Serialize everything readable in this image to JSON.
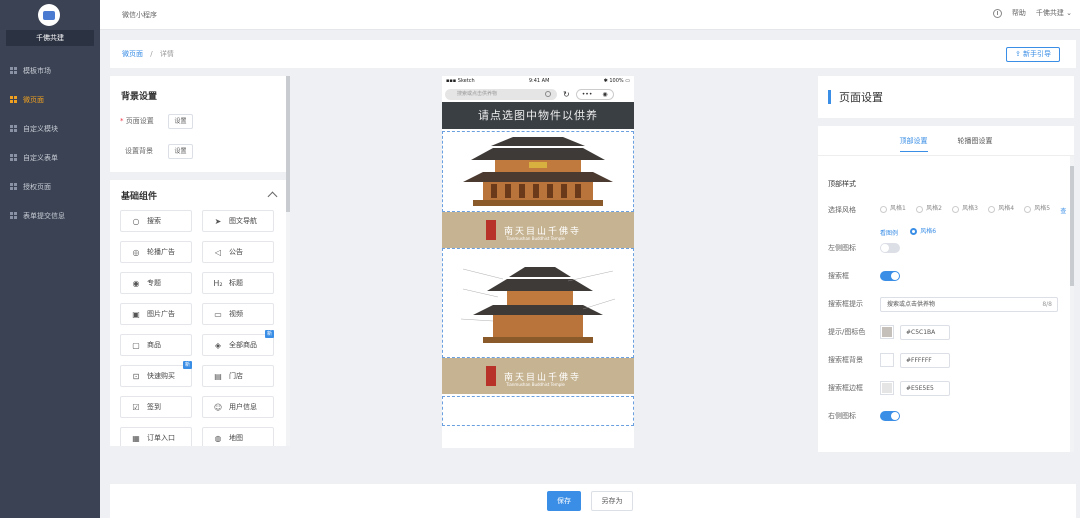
{
  "sidebar": {
    "brand": "千佛共建",
    "items": [
      {
        "label": "模板市场",
        "active": false
      },
      {
        "label": "微页面",
        "active": true
      },
      {
        "label": "自定义模块",
        "active": false
      },
      {
        "label": "自定义表单",
        "active": false
      },
      {
        "label": "授权页面",
        "active": false
      },
      {
        "label": "表单提交信息",
        "active": false
      }
    ]
  },
  "topbar": {
    "title": "微信小程序",
    "help_label": "帮助",
    "user_label": "千佛共建"
  },
  "breadcrumb": {
    "home": "微页面",
    "separator": "/",
    "current": "详情",
    "guide_label": "新手引导"
  },
  "left_panel": {
    "bg_title": "背景设置",
    "page_bg_label": "页面设置",
    "page_bg_btn": "设置",
    "bg_img_label": "设置背景",
    "bg_img_btn": "设置",
    "components_title": "基础组件",
    "components": [
      {
        "label": "搜索",
        "icon": "search-icon",
        "glyph": "○",
        "tag": ""
      },
      {
        "label": "图文导航",
        "icon": "send-icon",
        "glyph": "➤",
        "tag": ""
      },
      {
        "label": "轮播广告",
        "icon": "carousel-icon",
        "glyph": "◎",
        "tag": ""
      },
      {
        "label": "公告",
        "icon": "speaker-icon",
        "glyph": "◁",
        "tag": ""
      },
      {
        "label": "专题",
        "icon": "topic-icon",
        "glyph": "◉",
        "tag": ""
      },
      {
        "label": "标题",
        "icon": "heading-icon",
        "glyph": "H₂",
        "tag": ""
      },
      {
        "label": "图片广告",
        "icon": "image-icon",
        "glyph": "▣",
        "tag": ""
      },
      {
        "label": "视频",
        "icon": "video-icon",
        "glyph": "▭",
        "tag": ""
      },
      {
        "label": "商品",
        "icon": "goods-icon",
        "glyph": "▢",
        "tag": ""
      },
      {
        "label": "全部商品",
        "icon": "cube-icon",
        "glyph": "◈",
        "tag": "新"
      },
      {
        "label": "快速购买",
        "icon": "cart-icon",
        "glyph": "⊡",
        "tag": "新"
      },
      {
        "label": "门店",
        "icon": "store-icon",
        "glyph": "▤",
        "tag": ""
      },
      {
        "label": "签到",
        "icon": "checkin-icon",
        "glyph": "☑",
        "tag": ""
      },
      {
        "label": "用户信息",
        "icon": "user-icon",
        "glyph": "☺",
        "tag": ""
      },
      {
        "label": "订单入口",
        "icon": "order-icon",
        "glyph": "▦",
        "tag": ""
      },
      {
        "label": "地图",
        "icon": "map-icon",
        "glyph": "◍",
        "tag": ""
      }
    ]
  },
  "phone": {
    "carrier": "Sketch",
    "time": "9:41 AM",
    "battery": "100%",
    "search_placeholder": "搜索或点击供养物",
    "banner_text": "请点选图中物件以供养",
    "temple_name": "南天目山千佛寺",
    "temple_sub": "Tianmushan Buddhist Temple"
  },
  "right_panel": {
    "title": "页面设置",
    "tab_top": "顶部设置",
    "tab_carousel": "轮播图设置",
    "section_top_style": "顶部样式",
    "style_label": "选择风格",
    "styles": [
      {
        "label": "风格1",
        "on": false
      },
      {
        "label": "风格2",
        "on": false
      },
      {
        "label": "风格3",
        "on": false
      },
      {
        "label": "风格4",
        "on": false
      },
      {
        "label": "风格5",
        "on": false
      },
      {
        "label": "风格6",
        "on": true
      }
    ],
    "view_example": "查看图例",
    "left_icon_label": "左侧图标",
    "left_icon_on": false,
    "search_box_label": "搜索框",
    "search_box_on": true,
    "search_hint_label": "搜索框提示",
    "search_hint_value": "搜索或点击供养物",
    "search_hint_count": "8/8",
    "hint_color_label": "提示/图标色",
    "hint_color": "#C5C1BA",
    "search_bg_label": "搜索框背景",
    "search_bg": "#FFFFFF",
    "search_border_label": "搜索框边框",
    "search_border": "#E5E5E5",
    "right_icon_label": "右侧图标",
    "right_icon_on": true
  },
  "footer": {
    "save_label": "保存",
    "save_as_label": "另存为"
  },
  "colors": {
    "accent": "#3a8ee6",
    "sidebar_bg": "#3a4253",
    "active_nav": "#f0a020"
  }
}
